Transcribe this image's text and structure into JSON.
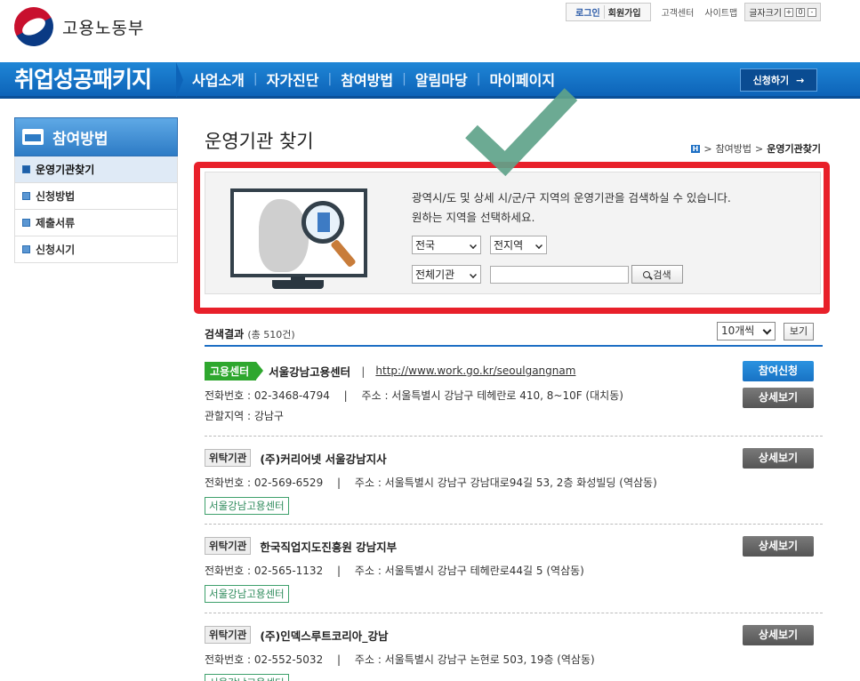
{
  "header": {
    "logo_text": "고용노동부",
    "util": {
      "login": "로그인",
      "join": "회원가입",
      "customer_center": "고객센터",
      "sitemap": "사이트맵",
      "font_size": "글자크기",
      "font_plus": "+",
      "font_reset": "0",
      "font_minus": "-"
    }
  },
  "gnb": {
    "brand": "취업성공패키지",
    "menu": [
      "사업소개",
      "자가진단",
      "참여방법",
      "알림마당",
      "마이페이지"
    ],
    "apply_button": "신청하기"
  },
  "lnb": {
    "title": "참여방법",
    "items": [
      "운영기관찾기",
      "신청방법",
      "제출서류",
      "신청시기"
    ]
  },
  "page": {
    "title": "운영기관 찾기",
    "breadcrumb": {
      "home": "H",
      "parent": "참여방법",
      "current": "운영기관찾기"
    }
  },
  "search": {
    "desc_line1": "광역시/도 및 상세 시/군/구 지역의 운영기관을 검색하실 수 있습니다.",
    "desc_line2": "원하는 지역을 선택하세요.",
    "region_select": "전국",
    "district_select": "전지역",
    "org_type_select": "전체기관",
    "keyword_value": "",
    "search_button": "검색"
  },
  "results": {
    "label": "검색결과",
    "count": "(총 510건)",
    "per_page": "10개씩",
    "view_button": "보기",
    "entries": [
      {
        "badge": "고용센터",
        "name": "서울강남고용센터",
        "url": "http://www.work.go.kr/seoulgangnam",
        "phone": "전화번호 : 02-3468-4794",
        "address": "주소 : 서울특별시 강남구 테헤란로 410, 8~10F (대치동)",
        "jurisdiction": "관할지역 : 강남구",
        "apply_button": "참여신청",
        "detail_button": "상세보기"
      },
      {
        "badge": "위탁기관",
        "name": "(주)커리어넷 서울강남지사",
        "phone": "전화번호 : 02-569-6529",
        "address": "주소 : 서울특별시 강남구 강남대로94길 53, 2층 화성빌딩 (역삼동)",
        "tag": "서울강남고용센터",
        "detail_button": "상세보기"
      },
      {
        "badge": "위탁기관",
        "name": "한국직업지도진흥원 강남지부",
        "phone": "전화번호 : 02-565-1132",
        "address": "주소 : 서울특별시 강남구 테헤란로44길 5 (역삼동)",
        "tag": "서울강남고용센터",
        "detail_button": "상세보기"
      },
      {
        "badge": "위탁기관",
        "name": "(주)인덱스루트코리아_강남",
        "phone": "전화번호 : 02-552-5032",
        "address": "주소 : 서울특별시 강남구 논현로 503, 19층 (역삼동)",
        "tag": "서울강남고용센터",
        "detail_button": "상세보기"
      }
    ]
  },
  "colors": {
    "nav_blue": "#0d63b8",
    "highlight_red": "#e8202a",
    "check_green": "#5fa38a",
    "badge_green": "#2ea72e"
  }
}
